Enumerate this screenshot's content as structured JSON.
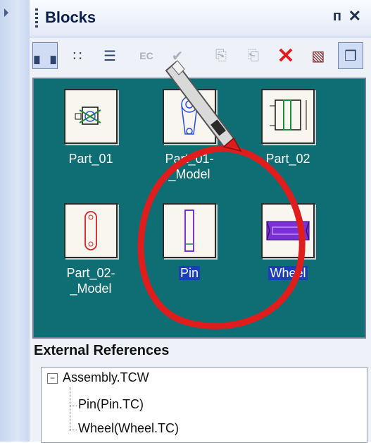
{
  "panel": {
    "title": "Blocks",
    "pin_icon": "pin-icon",
    "close_icon": "close-icon"
  },
  "toolbar": {
    "buttons": [
      {
        "icon": "view-large-icons-icon",
        "glyph": "▖▗",
        "active": true
      },
      {
        "icon": "view-small-icons-icon",
        "glyph": "∷",
        "active": false
      },
      {
        "icon": "view-list-icon",
        "glyph": "☰",
        "active": false
      },
      {
        "icon": "edit-contents-icon",
        "glyph": "EC",
        "active": false,
        "disabled": true
      },
      {
        "icon": "checkmark-icon",
        "glyph": "✔",
        "active": false,
        "disabled": true
      },
      {
        "icon": "copy-block-icon",
        "glyph": "⎘",
        "active": false,
        "disabled": true
      },
      {
        "icon": "paste-block-icon",
        "glyph": "⎗",
        "active": false,
        "disabled": true
      },
      {
        "icon": "delete-icon",
        "glyph": "✕",
        "active": false,
        "red": true
      },
      {
        "icon": "purge-icon",
        "glyph": "▧",
        "active": false
      },
      {
        "icon": "clipboard-icon",
        "glyph": "❐",
        "active": true
      }
    ]
  },
  "blocks": [
    {
      "label": "Part_01",
      "selected": false
    },
    {
      "label": "Part_01-\n_Model",
      "selected": false
    },
    {
      "label": "Part_02",
      "selected": false
    },
    {
      "label": "Part_02-\n_Model",
      "selected": false
    },
    {
      "label": "Pin",
      "selected": true
    },
    {
      "label": "Wheel",
      "selected": true
    }
  ],
  "external_references": {
    "title": "External References",
    "root": "Assembly.TCW",
    "children": [
      "Pin(Pin.TC)",
      "Wheel(Wheel.TC)"
    ]
  },
  "colors": {
    "canvas_bg": "#0f6e73",
    "selection": "#1a3fb8",
    "annotation_red": "#e01d1d"
  }
}
